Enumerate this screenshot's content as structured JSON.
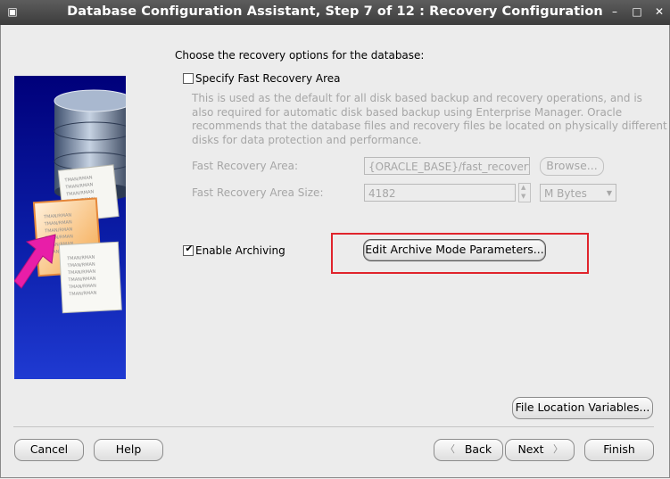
{
  "window": {
    "title": "Database Configuration Assistant, Step 7 of 12 : Recovery Configuration"
  },
  "main": {
    "heading": "Choose the recovery options for the database:",
    "fast_recovery": {
      "checkbox_label": "Specify Fast Recovery Area",
      "checked": false,
      "description": [
        "This is used as the default for all disk based backup and recovery operations, and is",
        "also required for automatic disk based backup using Enterprise Manager. Oracle",
        "recommends that the database files and recovery files be located on physically different",
        "disks for data protection and performance."
      ],
      "area_label": "Fast Recovery Area:",
      "area_value": "{ORACLE_BASE}/fast_recovery_a",
      "browse_label": "Browse...",
      "size_label": "Fast Recovery Area Size:",
      "size_value": "4182",
      "unit_value": "M Bytes"
    },
    "archiving": {
      "checkbox_label": "Enable Archiving",
      "checked": true,
      "edit_button": "Edit Archive Mode Parameters..."
    },
    "file_location_button": "File Location Variables..."
  },
  "footer": {
    "cancel": "Cancel",
    "help": "Help",
    "back": "Back",
    "next": "Next",
    "finish": "Finish"
  },
  "illustration": {
    "doc_lines": [
      "TMAN/RMAN",
      "TMAN/RMAN",
      "TMAN/RMAN",
      "TMAN/RMAN",
      "TMAN/RMAN",
      "TMAN/RMAN"
    ]
  },
  "colors": {
    "titlebar": "#4a4a4a",
    "panel_blue": "#0b1ea8",
    "highlight": "#e0242c",
    "arrow": "#e81ea8"
  }
}
